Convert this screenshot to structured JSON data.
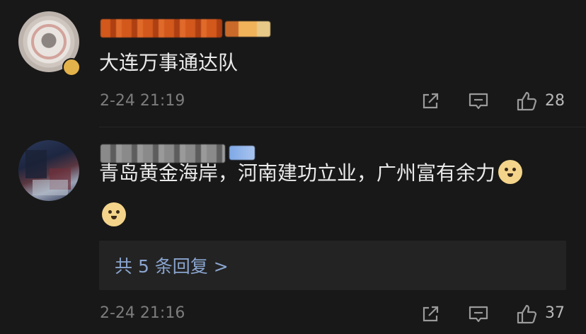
{
  "comments": [
    {
      "text": "大连万事通达队",
      "time": "2-24 21:19",
      "likes": "28"
    },
    {
      "text": "青岛黄金海岸，河南建功立业，广州富有余力",
      "time": "2-24 21:16",
      "likes": "37",
      "replies_label": "共 5 条回复 >"
    }
  ],
  "icons": {
    "share": "share-icon",
    "reply": "comment-icon",
    "like": "thumbs-up-icon",
    "emoji": "doge-emoji"
  },
  "colors": {
    "background": "#181818",
    "reply_link": "#8aa5cf",
    "muted": "#7c7c7c"
  }
}
